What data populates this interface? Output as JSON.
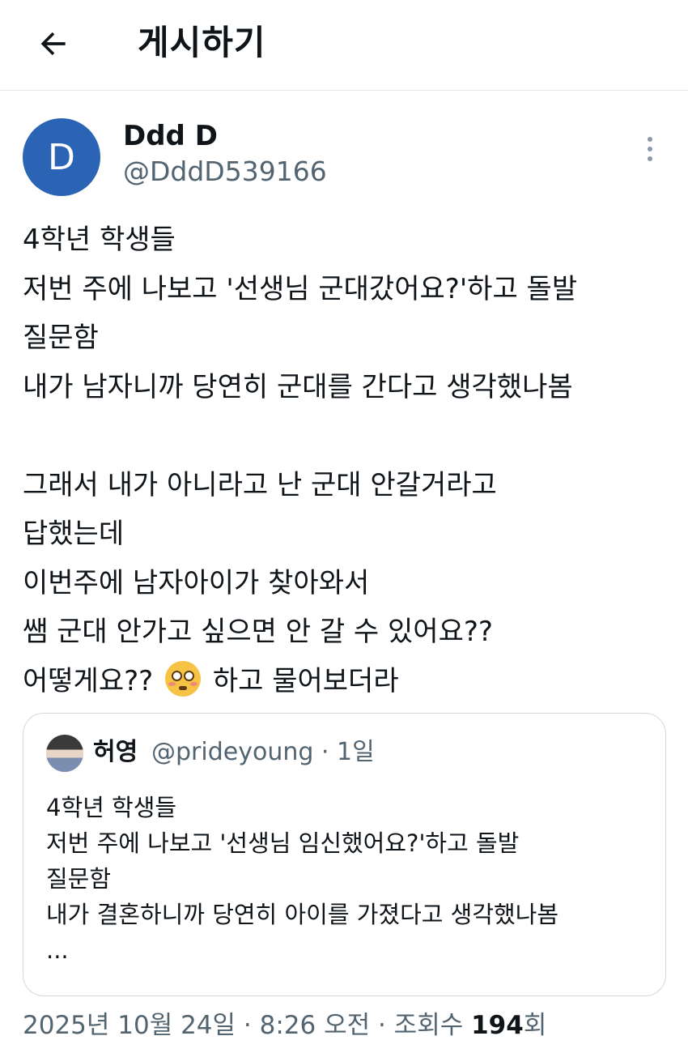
{
  "header": {
    "title": "게시하기"
  },
  "author": {
    "avatar_letter": "D",
    "display_name": "Ddd D",
    "handle": "@DddD539166"
  },
  "post": {
    "lines": [
      "4학년 학생들",
      "저번 주에 나보고 '선생님 군대갔어요?'하고 돌발",
      "질문함",
      "내가 남자니까 당연히 군대를 간다고 생각했나봄",
      "",
      "그래서 내가 아니라고 난 군대 안갈거라고",
      "답했는데",
      "이번주에 남자아이가 찾아와서",
      "쌤 군대 안가고 싶으면 안 갈 수 있어요??"
    ],
    "last_line_before_emoji": "어떻게요??",
    "last_line_after_emoji": "하고 물어보더라"
  },
  "quote": {
    "name": "허영",
    "handle_time": "@prideyoung · 1일",
    "lines": [
      "4학년 학생들",
      "저번 주에 나보고 '선생님 임신했어요?'하고 돌발",
      "질문함",
      "내가 결혼하니까 당연히 아이를 가졌다고 생각했나봄",
      "..."
    ]
  },
  "meta": {
    "timestamp": "2025년 10월 24일 · 8:26 오전 · 조회수 ",
    "views": "194",
    "views_unit": "회"
  }
}
